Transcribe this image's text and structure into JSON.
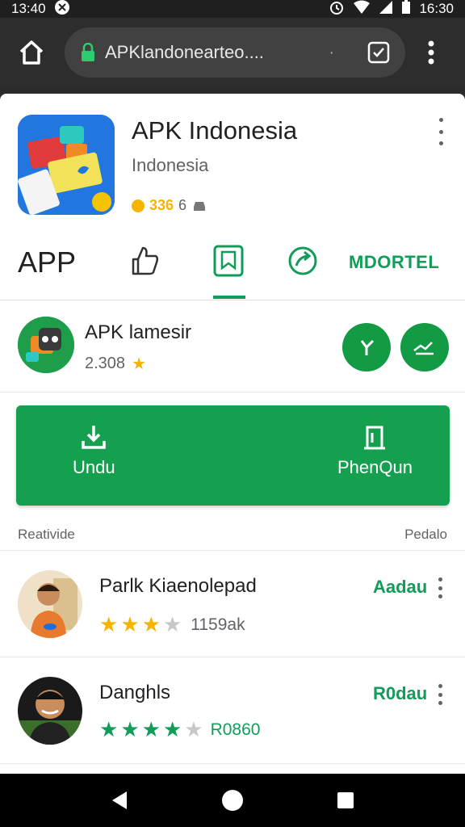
{
  "status_bar": {
    "time": "13:40",
    "right_time": "16:30"
  },
  "browser": {
    "url": "APKlandonearteo....",
    "url_suffix": "·"
  },
  "app": {
    "title": "APK Indonesia",
    "subtitle": "Indonesia",
    "meta_count": "336",
    "meta_extra": "6"
  },
  "tabs": {
    "app_label": "APP",
    "model_label": "MDORTEL"
  },
  "developer": {
    "name": "APK lamesir",
    "rating": "2.308"
  },
  "big_button": {
    "left_label": "Undu",
    "right_label": "PhenQun"
  },
  "section": {
    "left": "Reativide",
    "right": "Pedalo"
  },
  "list": [
    {
      "name": "Parlk Kiaenolepad",
      "rating_text": "1159ak",
      "action": "Aadau",
      "stars_filled": 3.5,
      "star_color": "#f5b400"
    },
    {
      "name": "Danghls",
      "rating_text": "R0860",
      "action": "R0dau",
      "stars_filled": 4,
      "star_color": "#0f9d58"
    }
  ],
  "colors": {
    "accent": "#0f9d58",
    "button": "#15a050",
    "star": "#f5b400"
  }
}
